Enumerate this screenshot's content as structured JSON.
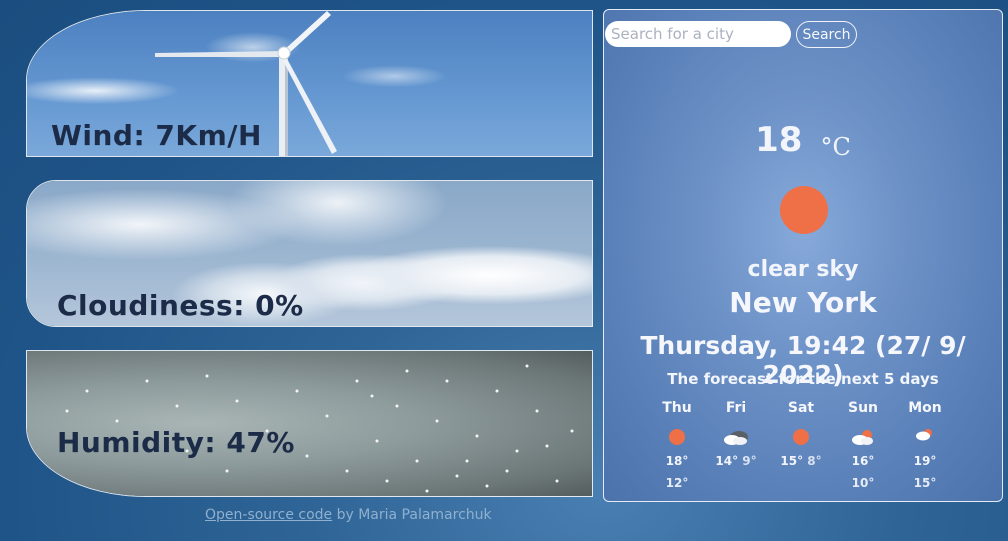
{
  "cards": {
    "wind": {
      "label": "Wind: 7Km/H"
    },
    "cloudiness": {
      "label": "Cloudiness: 0%"
    },
    "humidity": {
      "label": "Humidity: 47%"
    }
  },
  "footer": {
    "link_text": "Open-source code",
    "author_text": " by Maria Palamarchuk"
  },
  "search": {
    "placeholder": "Search for a city",
    "button_label": "Search"
  },
  "current": {
    "temperature": "18",
    "unit": "°C",
    "description": "clear sky",
    "city": "New York",
    "datetime": "Thursday, 19:42 (27/ 9/ 2022)",
    "sun_color": "#ef6f47"
  },
  "forecast": {
    "title": "The forecast for the next 5 days",
    "days": [
      {
        "day": "Thu",
        "icon": "sun-icon",
        "max": "18°",
        "min": "12°"
      },
      {
        "day": "Fri",
        "icon": "broken-clouds-icon",
        "max": "14°",
        "min": "9°"
      },
      {
        "day": "Sat",
        "icon": "sun-icon",
        "max": "15°",
        "min": "8°"
      },
      {
        "day": "Sun",
        "icon": "few-clouds-icon",
        "max": "16°",
        "min": "10°"
      },
      {
        "day": "Mon",
        "icon": "rain-icon",
        "max": "19°",
        "min": "15°"
      }
    ]
  }
}
